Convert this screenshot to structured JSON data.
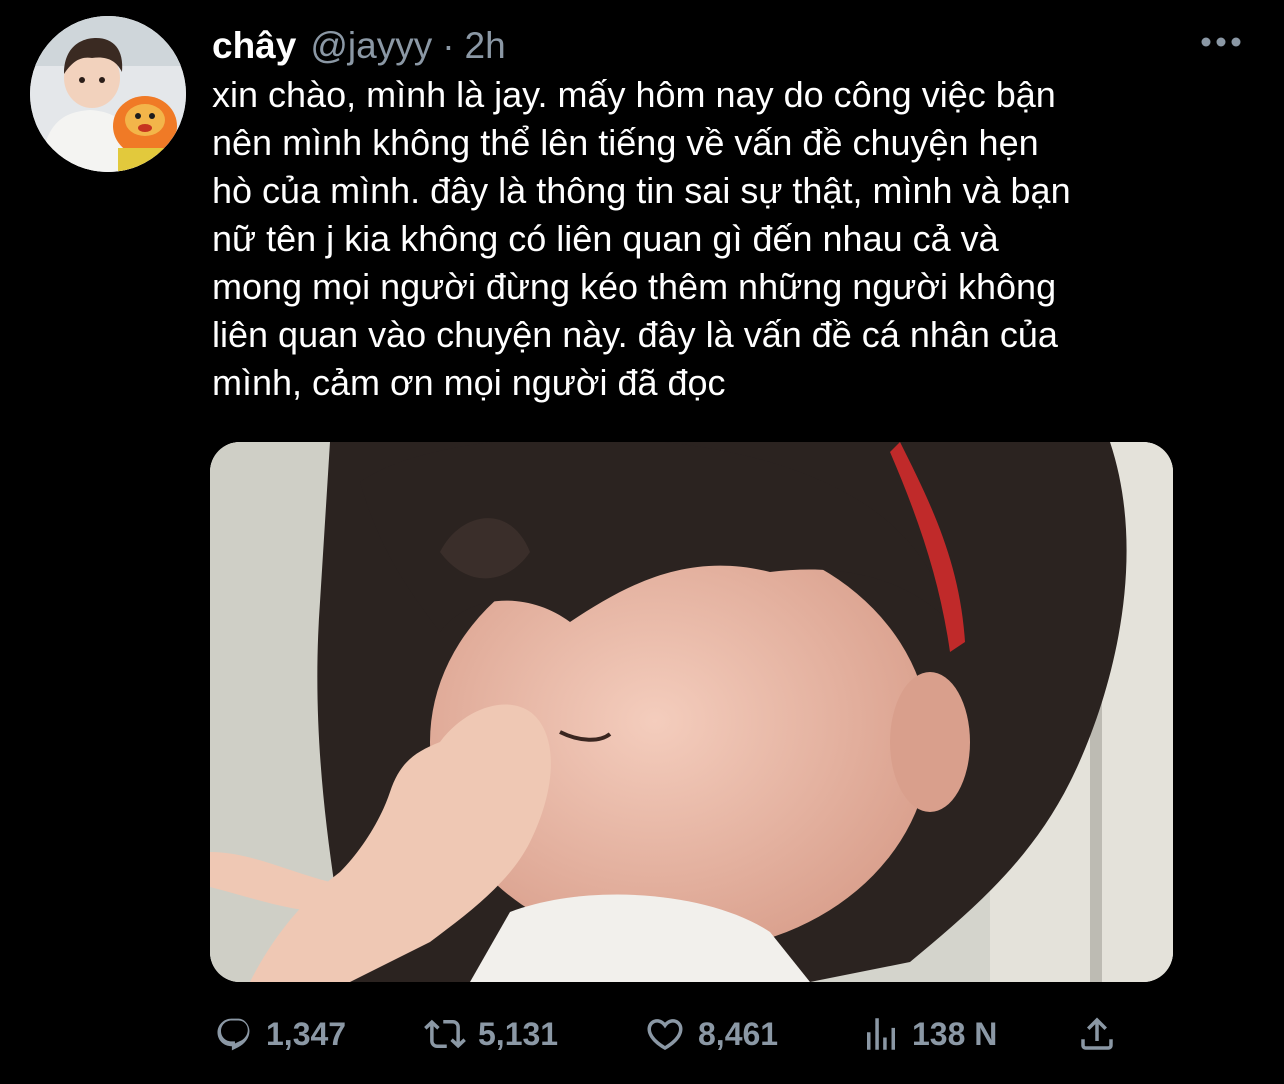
{
  "tweet": {
    "display_name": "châу",
    "handle": "@jаyyy",
    "separator": "·",
    "time": "2h",
    "text": "xin chào, mình là jay. mấy hôm nay do công việc bận\nnên mình không thể lên tiếng về vấn đề chuyện hẹn\nhò của mình. đây là thông tin sai sự thật, mình và bạn\nnữ tên j kia không có liên quan gì đến nhau cả và\nmong mọi người đừng kéo thêm những người không\nliên quan vào chuyện này. đây là vấn đề cá nhân của\nmình, cảm ơn mọi người đã đọc"
  },
  "actions": {
    "reply": {
      "icon": "reply-icon",
      "count": "1,347"
    },
    "retweet": {
      "icon": "retweet-icon",
      "count": "5,131"
    },
    "like": {
      "icon": "heart-icon",
      "count": "8,461"
    },
    "views": {
      "icon": "analytics-icon",
      "count": "138 N"
    },
    "share": {
      "icon": "share-icon"
    }
  },
  "colors": {
    "background": "#000000",
    "text_primary": "#ffffff",
    "text_secondary": "#8b98a5"
  }
}
